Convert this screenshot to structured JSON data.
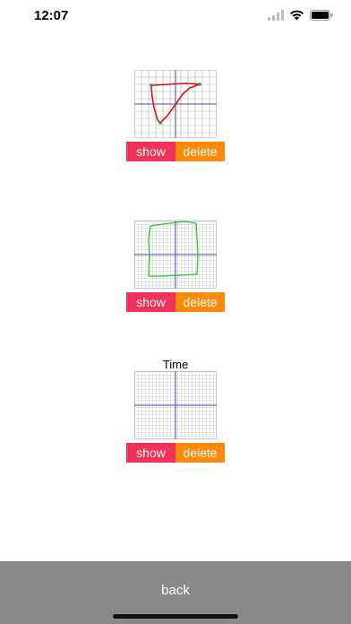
{
  "status_bar": {
    "time": "12:07"
  },
  "cards": [
    {
      "title": "",
      "show_label": "show",
      "delete_label": "delete",
      "drawing_color": "#e01010",
      "grid": "coarse"
    },
    {
      "title": "",
      "show_label": "show",
      "delete_label": "delete",
      "drawing_color": "#22cc22",
      "grid": "fine"
    },
    {
      "title": "Time",
      "show_label": "show",
      "delete_label": "delete",
      "drawing_color": "",
      "grid": "fine"
    }
  ],
  "bottom_bar": {
    "back_label": "back"
  },
  "colors": {
    "show_button": "#f0325a",
    "delete_button": "#fb8a0a",
    "bottom_bar": "#88888d",
    "axis": "#3b4bc8"
  }
}
